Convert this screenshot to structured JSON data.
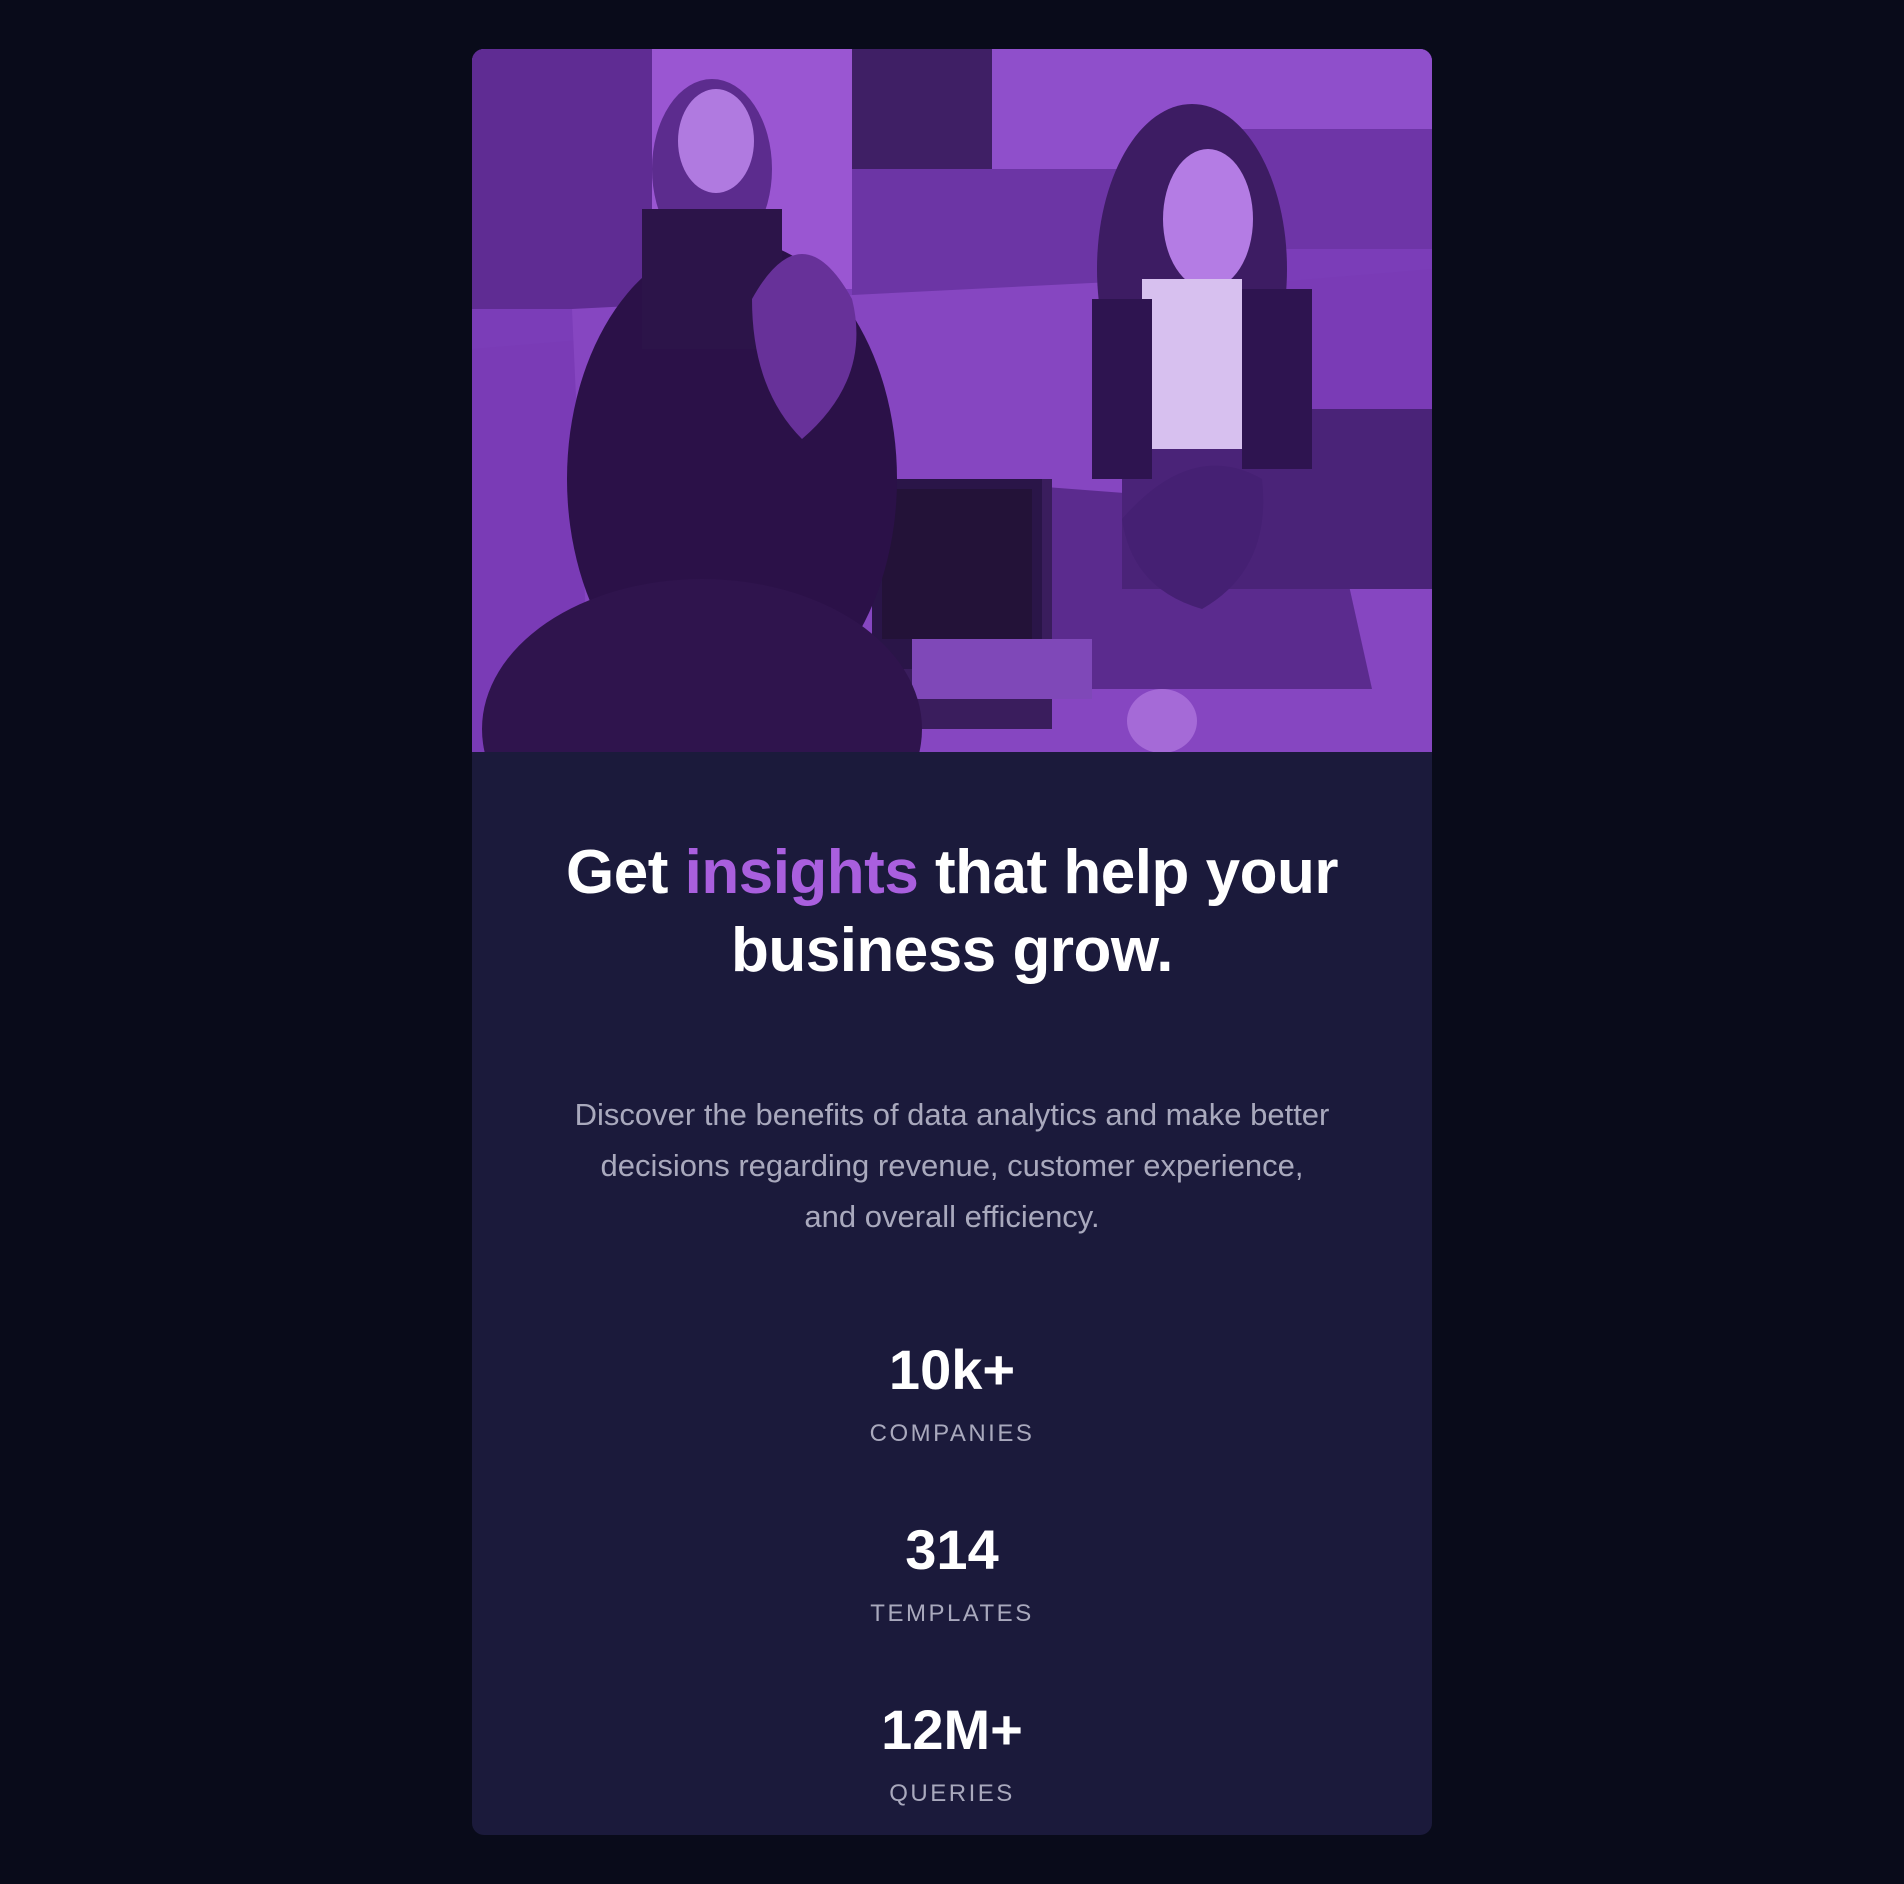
{
  "headline": {
    "prefix": "Get ",
    "accent": "insights",
    "suffix": " that help your business grow."
  },
  "description": "Discover the benefits of data analytics and make better decisions regarding revenue, customer experience, and overall efficiency.",
  "stats": [
    {
      "value": "10k+",
      "label": "COMPANIES"
    },
    {
      "value": "314",
      "label": "TEMPLATES"
    },
    {
      "value": "12M+",
      "label": "QUERIES"
    }
  ],
  "colors": {
    "page_background": "#090b1a",
    "card_background": "#1b1a3b",
    "accent": "#a95fde",
    "image_overlay": "#8d4fd0",
    "muted_text": "#a9a9bd"
  },
  "hero_image": {
    "icon": "office-team-photo",
    "description": "Purple-tinted photo of people working at a shared table with a laptop"
  }
}
